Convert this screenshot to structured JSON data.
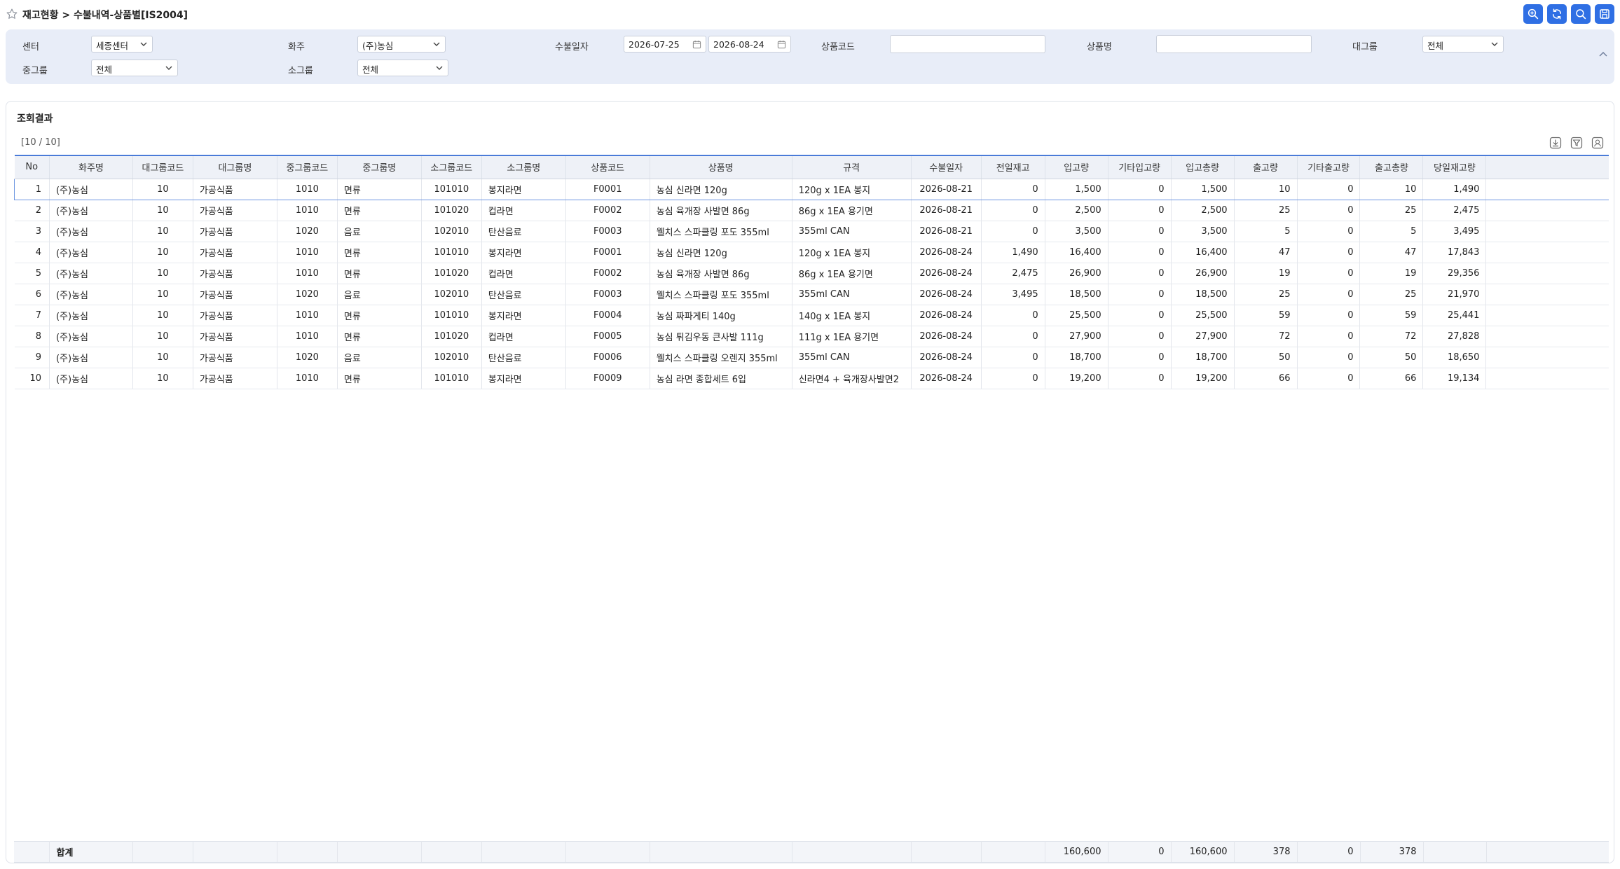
{
  "header": {
    "breadcrumb": "재고현황 > 수불내역-상품별[IS2004]",
    "actions": [
      {
        "name": "zoom-in-search-button",
        "icon": "magnifier-plus-icon"
      },
      {
        "name": "refresh-button",
        "icon": "refresh-icon"
      },
      {
        "name": "search-button",
        "icon": "search-icon"
      },
      {
        "name": "save-button",
        "icon": "save-icon"
      }
    ]
  },
  "filters": {
    "center_label": "센터",
    "center_value": "세종센터",
    "owner_label": "화주",
    "owner_value": "(주)농심",
    "date_label": "수불일자",
    "date_from": "2026-07-25",
    "date_to": "2026-08-24",
    "product_code_label": "상품코드",
    "product_code_value": "",
    "product_name_label": "상품명",
    "product_name_value": "",
    "large_group_label": "대그룹",
    "large_group_value": "전체",
    "mid_group_label": "중그룹",
    "mid_group_value": "전체",
    "small_group_label": "소그룹",
    "small_group_value": "전체"
  },
  "result": {
    "title": "조회결과",
    "count": "[10 / 10]",
    "columns": [
      "No",
      "화주명",
      "대그룹코드",
      "대그룹명",
      "중그룹코드",
      "중그룹명",
      "소그룹코드",
      "소그룹명",
      "상품코드",
      "상품명",
      "규격",
      "수불일자",
      "전일재고",
      "입고량",
      "기타입고량",
      "입고총량",
      "출고량",
      "기타출고량",
      "출고총량",
      "당일재고량"
    ],
    "rows": [
      [
        "1",
        "(주)농심",
        "10",
        "가공식품",
        "1010",
        "면류",
        "101010",
        "봉지라면",
        "F0001",
        "농심 신라면 120g",
        "120g x 1EA 봉지",
        "2026-08-21",
        "0",
        "1,500",
        "0",
        "1,500",
        "10",
        "0",
        "10",
        "1,490"
      ],
      [
        "2",
        "(주)농심",
        "10",
        "가공식품",
        "1010",
        "면류",
        "101020",
        "컵라면",
        "F0002",
        "농심 육개장 사발면 86g",
        "86g x 1EA 용기면",
        "2026-08-21",
        "0",
        "2,500",
        "0",
        "2,500",
        "25",
        "0",
        "25",
        "2,475"
      ],
      [
        "3",
        "(주)농심",
        "10",
        "가공식품",
        "1020",
        "음료",
        "102010",
        "탄산음료",
        "F0003",
        "웰치스 스파클링 포도 355ml",
        "355ml CAN",
        "2026-08-21",
        "0",
        "3,500",
        "0",
        "3,500",
        "5",
        "0",
        "5",
        "3,495"
      ],
      [
        "4",
        "(주)농심",
        "10",
        "가공식품",
        "1010",
        "면류",
        "101010",
        "봉지라면",
        "F0001",
        "농심 신라면 120g",
        "120g x 1EA 봉지",
        "2026-08-24",
        "1,490",
        "16,400",
        "0",
        "16,400",
        "47",
        "0",
        "47",
        "17,843"
      ],
      [
        "5",
        "(주)농심",
        "10",
        "가공식품",
        "1010",
        "면류",
        "101020",
        "컵라면",
        "F0002",
        "농심 육개장 사발면 86g",
        "86g x 1EA 용기면",
        "2026-08-24",
        "2,475",
        "26,900",
        "0",
        "26,900",
        "19",
        "0",
        "19",
        "29,356"
      ],
      [
        "6",
        "(주)농심",
        "10",
        "가공식품",
        "1020",
        "음료",
        "102010",
        "탄산음료",
        "F0003",
        "웰치스 스파클링 포도 355ml",
        "355ml CAN",
        "2026-08-24",
        "3,495",
        "18,500",
        "0",
        "18,500",
        "25",
        "0",
        "25",
        "21,970"
      ],
      [
        "7",
        "(주)농심",
        "10",
        "가공식품",
        "1010",
        "면류",
        "101010",
        "봉지라면",
        "F0004",
        "농심 짜파게티 140g",
        "140g x 1EA 봉지",
        "2026-08-24",
        "0",
        "25,500",
        "0",
        "25,500",
        "59",
        "0",
        "59",
        "25,441"
      ],
      [
        "8",
        "(주)농심",
        "10",
        "가공식품",
        "1010",
        "면류",
        "101020",
        "컵라면",
        "F0005",
        "농심 튀김우동 큰사발 111g",
        "111g x 1EA 용기면",
        "2026-08-24",
        "0",
        "27,900",
        "0",
        "27,900",
        "72",
        "0",
        "72",
        "27,828"
      ],
      [
        "9",
        "(주)농심",
        "10",
        "가공식품",
        "1020",
        "음료",
        "102010",
        "탄산음료",
        "F0006",
        "웰치스 스파클링 오렌지 355ml",
        "355ml CAN",
        "2026-08-24",
        "0",
        "18,700",
        "0",
        "18,700",
        "50",
        "0",
        "50",
        "18,650"
      ],
      [
        "10",
        "(주)농심",
        "10",
        "가공식품",
        "1010",
        "면류",
        "101010",
        "봉지라면",
        "F0009",
        "농심 라면 종합세트 6입",
        "신라면4 + 육개장사발면2",
        "2026-08-24",
        "0",
        "19,200",
        "0",
        "19,200",
        "66",
        "0",
        "66",
        "19,134"
      ]
    ],
    "totals": {
      "label": "합계",
      "in_qty": "160,600",
      "etc_in_qty": "0",
      "in_total": "160,600",
      "out_qty": "378",
      "etc_out_qty": "0",
      "out_total": "378"
    }
  },
  "colors": {
    "accent": "#2f6fe4",
    "filter_bg": "#e8edf8",
    "header_bg": "#eef1f7"
  }
}
